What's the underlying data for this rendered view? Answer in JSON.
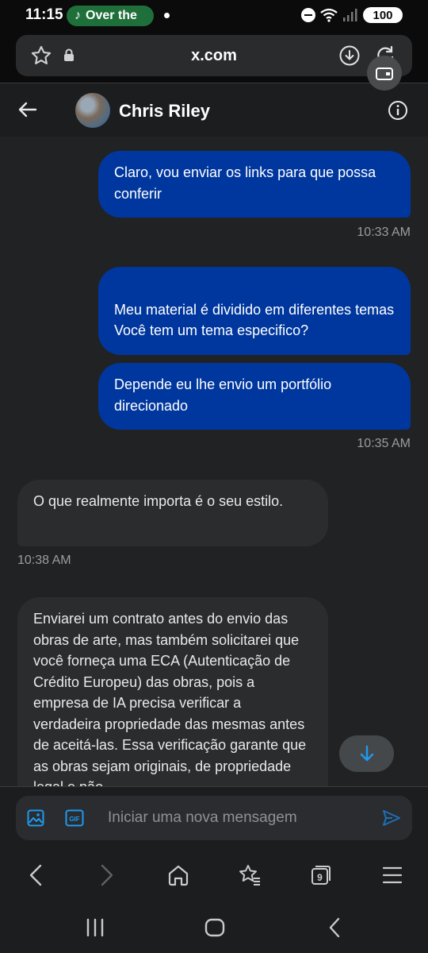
{
  "status": {
    "time": "11:15",
    "media_label": "Over the",
    "battery": "100"
  },
  "browser": {
    "url": "x.com",
    "tab_count": "9"
  },
  "conversation": {
    "contact_name": "Chris Riley",
    "messages": [
      {
        "direction": "out",
        "text": "Claro, vou enviar os links para que possa conferir"
      },
      {
        "direction": "out",
        "text": "Meu material é dividido em diferentes temas\nVocê tem um tema especifico?"
      },
      {
        "direction": "out",
        "text": "Depende eu lhe envio um portfólio direcionado"
      },
      {
        "direction": "in",
        "text": "O que realmente importa é o seu estilo."
      },
      {
        "direction": "in",
        "text": "Enviarei um contrato antes do envio das obras de arte, mas também solicitarei que você forneça uma ECA (Autenticação de Crédito Europeu) das obras, pois a empresa de IA precisa verificar a verdadeira propriedade das mesmas antes de aceitá-las. Essa verificação garante que as obras sejam originais, de propriedade legal e não"
      }
    ],
    "timestamps": [
      "10:33 AM",
      "10:35 AM",
      "10:38 AM"
    ]
  },
  "composer": {
    "placeholder": "Iniciar uma nova mensagem",
    "gif_label": "GIF"
  },
  "colors": {
    "outgoing_bubble": "#00379e",
    "incoming_bubble": "#2b2c2e",
    "accent": "#1d9bf0"
  },
  "icons": [
    "star-icon",
    "lock-icon",
    "download-icon",
    "reload-icon",
    "tab-switch-icon",
    "back-arrow-icon",
    "info-icon",
    "image-icon",
    "gif-icon",
    "send-icon",
    "arrow-down-icon",
    "home-icon",
    "bookmarks-icon",
    "tabs-icon",
    "menu-icon",
    "recents-icon",
    "home-button-icon",
    "system-back-icon"
  ]
}
